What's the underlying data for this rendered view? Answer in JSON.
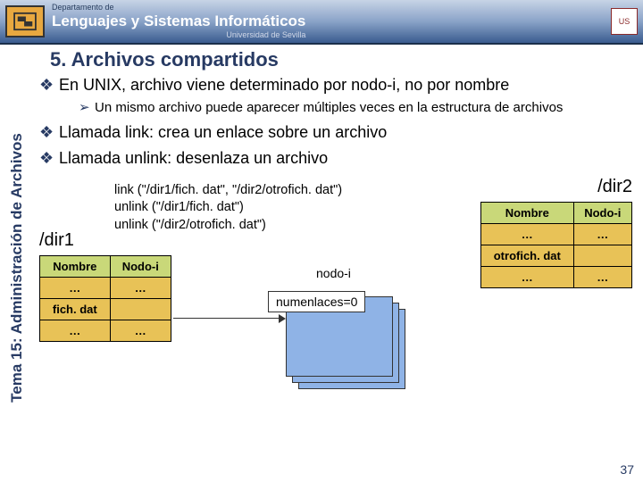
{
  "banner": {
    "dept": "Departamento de",
    "name": "Lenguajes y Sistemas Informáticos",
    "univ": "Universidad de Sevilla",
    "seal": "US"
  },
  "sidebar": "Tema 15: Administración de Archivos",
  "title": "5. Archivos compartidos",
  "bullets": {
    "b1": "En UNIX, archivo viene determinado por nodo-i, no por nombre",
    "b1_sub": "Un mismo archivo puede aparecer múltiples veces en la estructura de archivos",
    "b2": "Llamada link: crea un enlace sobre un archivo",
    "b3": "Llamada unlink: desenlaza un archivo"
  },
  "code": {
    "l1": "link (\"/dir1/fich. dat\", \"/dir2/otrofich. dat\")",
    "l2": "unlink (\"/dir1/fich. dat\")",
    "l3": "unlink (\"/dir2/otrofich. dat\")"
  },
  "labels": {
    "dir1": "/dir1",
    "dir2": "/dir2",
    "nombre": "Nombre",
    "nodoi": "Nodo-i",
    "dots": "…",
    "fich": "fich. dat",
    "otrofich": "otrofich. dat",
    "nodoi_caption": "nodo-i",
    "numenlaces": "numenlaces=0"
  },
  "page": "37"
}
